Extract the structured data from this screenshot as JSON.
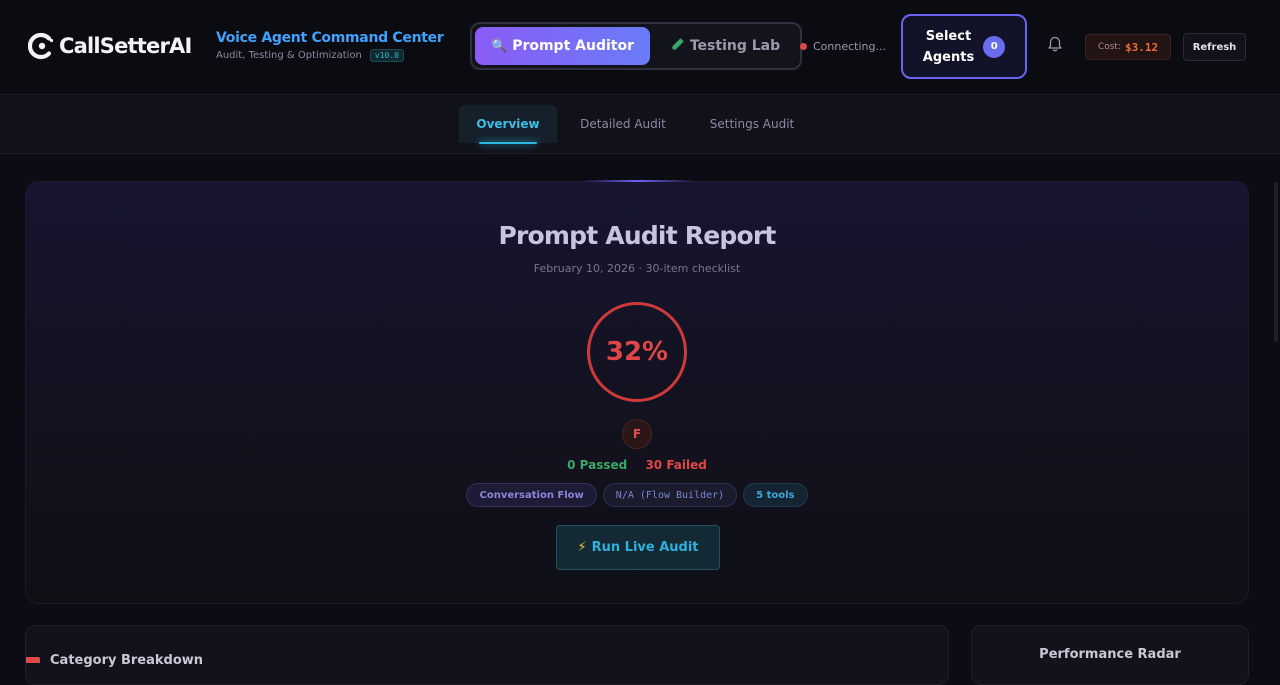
{
  "header": {
    "logo_text": "CallSetterAI",
    "brand_title": "Voice Agent Command Center",
    "brand_subtitle": "Audit, Testing & Optimization",
    "version": "v10.0",
    "modes": [
      {
        "label": "Prompt Auditor",
        "icon": "magnifier-icon",
        "active": true
      },
      {
        "label": "Testing Lab",
        "icon": "test-tube-icon",
        "active": false
      }
    ],
    "connection_status": "Connecting...",
    "select_agents": {
      "label_line1": "Select",
      "label_line2": "Agents",
      "count": "0"
    },
    "cost_label": "Cost:",
    "cost_value": "$3.12",
    "refresh_label": "Refresh"
  },
  "tabs": [
    {
      "label": "Overview",
      "active": true
    },
    {
      "label": "Detailed Audit",
      "active": false
    },
    {
      "label": "Settings Audit",
      "active": false
    }
  ],
  "report": {
    "title": "Prompt Audit Report",
    "meta": "February 10, 2026 · 30-item checklist",
    "score": "32%",
    "grade": "F",
    "passed": "0 Passed",
    "failed": "30 Failed",
    "chips": [
      "Conversation Flow",
      "N/A (Flow Builder)",
      "5 tools"
    ],
    "run_button": "Run Live Audit"
  },
  "panels": {
    "category_breakdown": "Category Breakdown",
    "performance_radar": "Performance Radar"
  },
  "colors": {
    "accent_purple": "#8a5cf6",
    "accent_cyan": "#2bb8e0",
    "fail_red": "#e04848",
    "pass_green": "#3aa86a"
  }
}
